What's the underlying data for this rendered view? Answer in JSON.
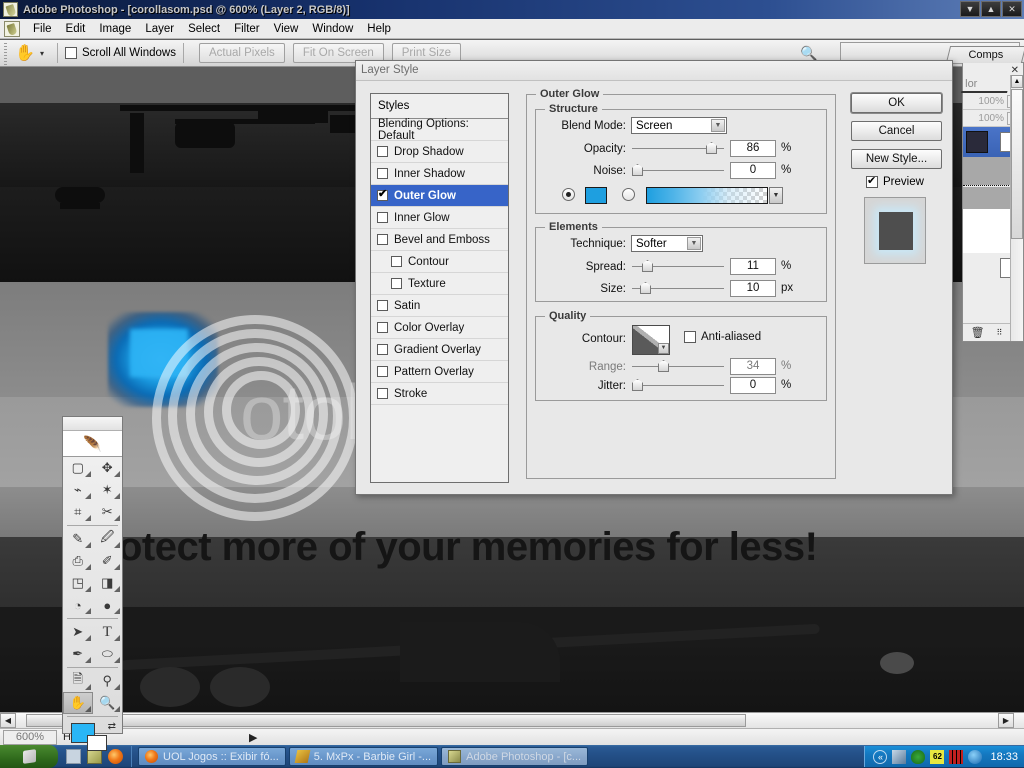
{
  "window": {
    "title": "Adobe Photoshop - [corollasom.psd @ 600% (Layer 2, RGB/8)]",
    "app_icon": "photoshop-icon",
    "minimize_label": "▼",
    "maximize_label": "▲",
    "close_label": "✕"
  },
  "menubar": {
    "items": [
      "File",
      "Edit",
      "Image",
      "Layer",
      "Select",
      "Filter",
      "View",
      "Window",
      "Help"
    ]
  },
  "options_bar": {
    "tool_icon": "hand-tool-icon",
    "tool_preset_caret": "▾",
    "scroll_all_windows_label": "Scroll All Windows",
    "scroll_all_windows_checked": false,
    "buttons": [
      "Actual Pixels",
      "Fit On Screen",
      "Print Size"
    ],
    "zoom_icon": "magnifier-icon"
  },
  "canvas": {
    "banner_text": "otect more of your memories for less!",
    "watermark_text": "otobucket",
    "watermark_icon": "photobucket-spiral-icon"
  },
  "toolbox": {
    "logo_icon": "feather-logo-icon",
    "tools": [
      {
        "name": "marquee-tool",
        "glyph": "▢"
      },
      {
        "name": "move-tool",
        "glyph": "✥"
      },
      {
        "name": "lasso-tool",
        "glyph": "⌇"
      },
      {
        "name": "magic-wand-tool",
        "glyph": "✶"
      },
      {
        "name": "crop-tool",
        "glyph": "⌗"
      },
      {
        "name": "slice-tool",
        "glyph": "✂"
      },
      {
        "name": "healing-brush-tool",
        "glyph": "✎"
      },
      {
        "name": "brush-tool",
        "glyph": "🖌"
      },
      {
        "name": "clone-stamp-tool",
        "glyph": "⎙"
      },
      {
        "name": "history-brush-tool",
        "glyph": "✐"
      },
      {
        "name": "eraser-tool",
        "glyph": "◳"
      },
      {
        "name": "gradient-tool",
        "glyph": "◨"
      },
      {
        "name": "blur-tool",
        "glyph": "◕"
      },
      {
        "name": "dodge-tool",
        "glyph": "●"
      },
      {
        "name": "path-selection-tool",
        "glyph": "➤"
      },
      {
        "name": "type-tool",
        "glyph": "T"
      },
      {
        "name": "pen-tool",
        "glyph": "✒"
      },
      {
        "name": "ellipse-tool",
        "glyph": "⬭"
      },
      {
        "name": "notes-tool",
        "glyph": "🗎"
      },
      {
        "name": "eyedropper-tool",
        "glyph": "⚲"
      },
      {
        "name": "hand-tool",
        "glyph": "✋",
        "selected": true
      },
      {
        "name": "zoom-tool",
        "glyph": "🔍"
      }
    ],
    "foreground_color": "#29b6f6",
    "background_color": "#ffffff",
    "swap_icon": "swap-colors-icon"
  },
  "palettes": {
    "comps_tab_label": "Comps",
    "color_tab_label": "lor",
    "close_icon": "close-icon",
    "opacity_rows": [
      "100%",
      "100%"
    ],
    "trash_icon": "trash-icon"
  },
  "dialog": {
    "title": "Layer Style",
    "styles_header": "Styles",
    "styles": [
      {
        "label": "Blending Options: Default",
        "checkbox": false,
        "has_checkbox": false,
        "indent": false,
        "active": false
      },
      {
        "label": "Drop Shadow",
        "checkbox": false,
        "has_checkbox": true,
        "indent": false,
        "active": false
      },
      {
        "label": "Inner Shadow",
        "checkbox": false,
        "has_checkbox": true,
        "indent": false,
        "active": false
      },
      {
        "label": "Outer Glow",
        "checkbox": true,
        "has_checkbox": true,
        "indent": false,
        "active": true
      },
      {
        "label": "Inner Glow",
        "checkbox": false,
        "has_checkbox": true,
        "indent": false,
        "active": false
      },
      {
        "label": "Bevel and Emboss",
        "checkbox": false,
        "has_checkbox": true,
        "indent": false,
        "active": false
      },
      {
        "label": "Contour",
        "checkbox": false,
        "has_checkbox": true,
        "indent": true,
        "active": false
      },
      {
        "label": "Texture",
        "checkbox": false,
        "has_checkbox": true,
        "indent": true,
        "active": false
      },
      {
        "label": "Satin",
        "checkbox": false,
        "has_checkbox": true,
        "indent": false,
        "active": false
      },
      {
        "label": "Color Overlay",
        "checkbox": false,
        "has_checkbox": true,
        "indent": false,
        "active": false
      },
      {
        "label": "Gradient Overlay",
        "checkbox": false,
        "has_checkbox": true,
        "indent": false,
        "active": false
      },
      {
        "label": "Pattern Overlay",
        "checkbox": false,
        "has_checkbox": true,
        "indent": false,
        "active": false
      },
      {
        "label": "Stroke",
        "checkbox": false,
        "has_checkbox": true,
        "indent": false,
        "active": false
      }
    ],
    "panel_title": "Outer Glow",
    "structure": {
      "group_label": "Structure",
      "blend_mode_label": "Blend Mode:",
      "blend_mode_value": "Screen",
      "opacity_label": "Opacity:",
      "opacity_value": "86",
      "opacity_unit": "%",
      "noise_label": "Noise:",
      "noise_value": "0",
      "noise_unit": "%",
      "color_radio_selected": true,
      "glow_color": "#1e9fe0",
      "gradient_radio_selected": false
    },
    "elements": {
      "group_label": "Elements",
      "technique_label": "Technique:",
      "technique_value": "Softer",
      "spread_label": "Spread:",
      "spread_value": "11",
      "spread_unit": "%",
      "size_label": "Size:",
      "size_value": "10",
      "size_unit": "px"
    },
    "quality": {
      "group_label": "Quality",
      "contour_label": "Contour:",
      "anti_aliased_label": "Anti-aliased",
      "anti_aliased_checked": false,
      "range_label": "Range:",
      "range_value": "34",
      "range_unit": "%",
      "jitter_label": "Jitter:",
      "jitter_value": "0",
      "jitter_unit": "%"
    },
    "buttons": {
      "ok": "OK",
      "cancel": "Cancel",
      "new_style": "New Style...",
      "preview_label": "Preview",
      "preview_checked": true
    }
  },
  "status": {
    "zoom": "600%",
    "doc_label": "H:",
    "scroll_arrow": "▶"
  },
  "taskbar": {
    "start_label": "start",
    "quick_launch": [
      "show-desktop-icon",
      "photoshop-icon",
      "firefox-icon"
    ],
    "tasks": [
      {
        "label": "UOL Jogos :: Exibir fó...",
        "icon": "firefox-icon",
        "active": false
      },
      {
        "label": "5. MxPx - Barbie Girl -...",
        "icon": "winamp-icon",
        "active": false
      },
      {
        "label": "Adobe Photoshop - [c...",
        "icon": "photoshop-icon",
        "active": true
      }
    ],
    "tray_icons": [
      "expand-icon",
      "network-icon",
      "shield-icon",
      "battery-62-icon",
      "meter-icon",
      "messenger-icon"
    ],
    "battery_label": "62",
    "clock": "18:33"
  }
}
